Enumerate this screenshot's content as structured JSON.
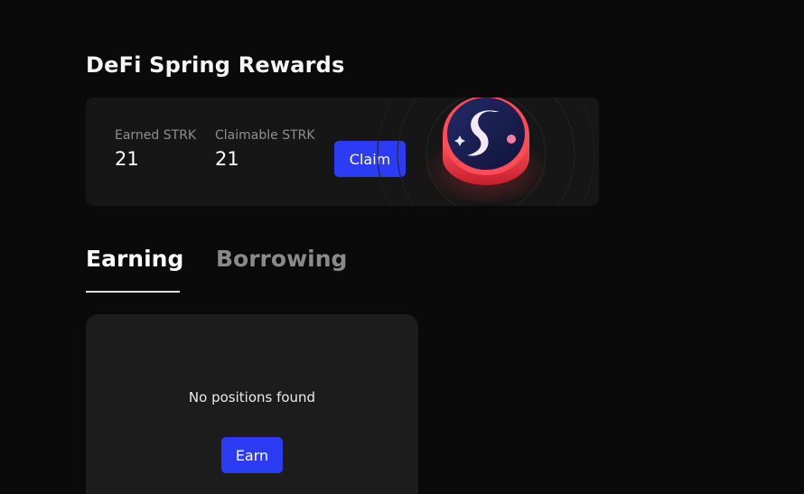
{
  "page": {
    "title": "DeFi Spring Rewards"
  },
  "rewards": {
    "earned_label": "Earned STRK",
    "earned_value": "21",
    "claimable_label": "Claimable STRK",
    "claimable_value": "21",
    "claim_label": "Claim"
  },
  "tabs": [
    {
      "label": "Earning",
      "active": true
    },
    {
      "label": "Borrowing",
      "active": false
    }
  ],
  "positions": {
    "empty_message": "No positions found",
    "earn_label": "Earn"
  },
  "colors": {
    "background": "#0a0a0a",
    "card": "#161616",
    "accent_button": "#2c3cf5",
    "token_red": "#ff4b55",
    "token_navy": "#1a1f4a"
  },
  "icons": {
    "token": "strk-token-icon"
  }
}
